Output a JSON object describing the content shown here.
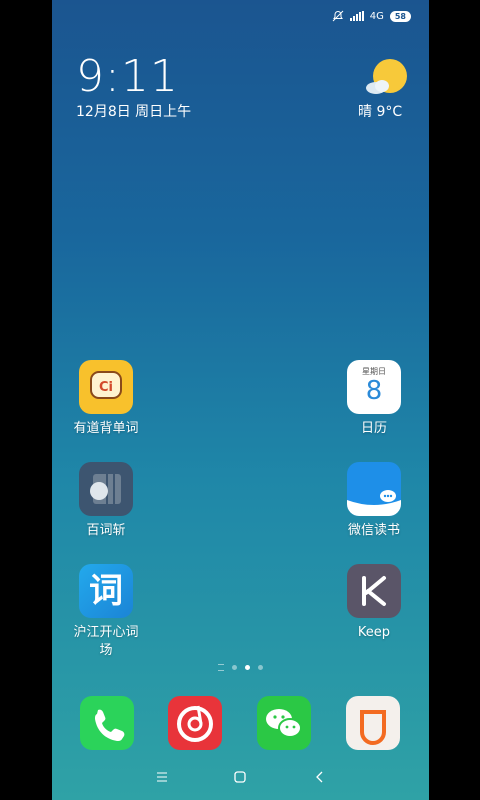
{
  "status_bar": {
    "network": "4G",
    "battery": "58"
  },
  "lock_widget": {
    "time": "9:11",
    "date": "12月8日 周日上午",
    "weather": "晴  9°C"
  },
  "apps": [
    {
      "label": "有道背单词",
      "icon": "youdao-ci-icon"
    },
    {
      "label": "日历",
      "icon": "calendar-icon",
      "calendar_header": "星期日",
      "calendar_day": "8"
    },
    {
      "label": "百词斩",
      "icon": "baicizhan-icon"
    },
    {
      "label": "微信读书",
      "icon": "weixin-read-icon"
    },
    {
      "label": "沪江开心词场",
      "icon": "hujiang-ci-icon",
      "glyph": "词"
    },
    {
      "label": "Keep",
      "icon": "keep-icon"
    }
  ],
  "dock": [
    {
      "name": "phone",
      "icon": "phone-icon"
    },
    {
      "name": "netease-music",
      "icon": "netease-music-icon"
    },
    {
      "name": "wechat",
      "icon": "wechat-icon"
    },
    {
      "name": "didi",
      "icon": "didi-icon"
    }
  ],
  "page_indicator": {
    "count": 3,
    "active": 1
  },
  "colors": {
    "wallpaper_top": "#1b5590",
    "wallpaper_bottom": "#2fa2a6"
  }
}
